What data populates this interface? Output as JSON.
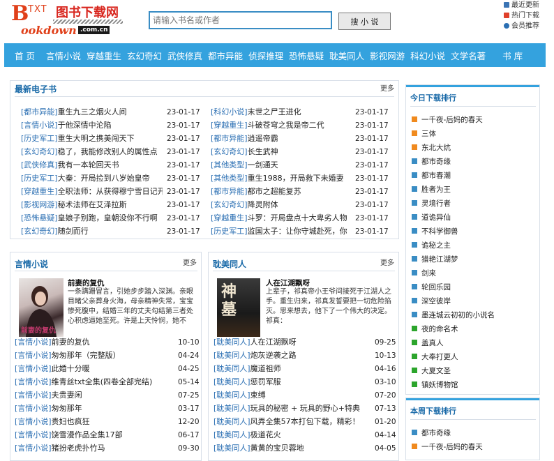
{
  "logo": {
    "txt": "TXT",
    "cn": "图书下载网",
    "b": "B",
    "bottom": "ookdown",
    "com": ".com.cn"
  },
  "search": {
    "placeholder": "请输入书名或作者",
    "button": "搜 小 说"
  },
  "toplinks": [
    {
      "label": "最近更新",
      "icon": "home-icon"
    },
    {
      "label": "热门下载",
      "icon": "chart-icon"
    },
    {
      "label": "会员推荐",
      "icon": "user-icon"
    }
  ],
  "nav": [
    "首 页",
    "言情小说",
    "穿越重生",
    "玄幻奇幻",
    "武侠修真",
    "都市异能",
    "侦探推理",
    "恐怖悬疑",
    "耽美同人",
    "影视网游",
    "科幻小说",
    "文学名著",
    "书 库"
  ],
  "latest": {
    "title": "最新电子书",
    "more": "更多",
    "left": [
      {
        "cat": "[都市异能]",
        "name": "重生九三之烟火人间",
        "date": "23-01-17"
      },
      {
        "cat": "[言情小说]",
        "name": "于他深情中沦陷",
        "date": "23-01-17"
      },
      {
        "cat": "[历史军工]",
        "name": "重生大明之携美闯天下",
        "date": "23-01-17"
      },
      {
        "cat": "[玄幻奇幻]",
        "name": "稳了，我能修改别人的属性点",
        "date": "23-01-17"
      },
      {
        "cat": "[武侠修真]",
        "name": "我有一本轮回天书",
        "date": "23-01-17"
      },
      {
        "cat": "[历史军工]",
        "name": "大秦：开局捡到八岁始皇帝",
        "date": "23-01-17"
      },
      {
        "cat": "[穿越重生]",
        "name": "全职法师：从获得穆宁雪日记开始",
        "date": "23-01-17"
      },
      {
        "cat": "[影视网游]",
        "name": "秘术法师在艾泽拉斯",
        "date": "23-01-17"
      },
      {
        "cat": "[恐怖悬疑]",
        "name": "皇娘子别跑，皇朝没你不行啊",
        "date": "23-01-17"
      },
      {
        "cat": "[玄幻奇幻]",
        "name": "随剑而行",
        "date": "23-01-17"
      }
    ],
    "right": [
      {
        "cat": "[科幻小说]",
        "name": "末世之尸王进化",
        "date": "23-01-17"
      },
      {
        "cat": "[穿越重生]",
        "name": "斗破苍穹之我是帝二代",
        "date": "23-01-17"
      },
      {
        "cat": "[都市异能]",
        "name": "逍遥帝霸",
        "date": "23-01-17"
      },
      {
        "cat": "[玄幻奇幻]",
        "name": "长生武神",
        "date": "23-01-17"
      },
      {
        "cat": "[其他类型]",
        "name": "一剑通天",
        "date": "23-01-17"
      },
      {
        "cat": "[其他类型]",
        "name": "重生1988，开局救下未婚妻",
        "date": "23-01-17"
      },
      {
        "cat": "[都市异能]",
        "name": "都市之超能复苏",
        "date": "23-01-17"
      },
      {
        "cat": "[玄幻奇幻]",
        "name": "降灵附体",
        "date": "23-01-17"
      },
      {
        "cat": "[穿越重生]",
        "name": "斗罗：开局盘点十大卑劣人物",
        "date": "23-01-17"
      },
      {
        "cat": "[历史军工]",
        "name": "监国太子：让你守城赴死，你",
        "date": "23-01-17"
      }
    ]
  },
  "romance": {
    "title": "言情小说",
    "more": "更多",
    "feature": {
      "title": "前妻的复仇",
      "cover_text": "前妻的复仇",
      "desc": "一条蹒跚冒言，引她步步踏入深渊。亲眼目睹父亲葬身火海，母亲精神失常，宝宝惨死腹中，结婚三年的丈夫勾结第三者处心积虑逼她至死。许是上天怜悯，她不"
    },
    "items": [
      {
        "cat": "[言情小说]",
        "name": "前妻的复仇",
        "date": "10-10"
      },
      {
        "cat": "[言情小说]",
        "name": "匆匆那年（完整版）",
        "date": "04-24"
      },
      {
        "cat": "[言情小说]",
        "name": "此婚十分暖",
        "date": "04-25"
      },
      {
        "cat": "[言情小说]",
        "name": "维青丝txt全集(四卷全部完结)",
        "date": "05-14"
      },
      {
        "cat": "[言情小说]",
        "name": "夫贵妻闲",
        "date": "07-25"
      },
      {
        "cat": "[言情小说]",
        "name": "匆匆那年",
        "date": "03-17"
      },
      {
        "cat": "[言情小说]",
        "name": "贵妇也疯狂",
        "date": "12-20"
      },
      {
        "cat": "[言情小说]",
        "name": "饶雪漫作品全集17部",
        "date": "06-17"
      },
      {
        "cat": "[言情小说]",
        "name": "猪扮老虎扑竹马",
        "date": "09-30"
      }
    ]
  },
  "bl": {
    "title": "耽美同人",
    "more": "更多",
    "feature": {
      "title": "人在江湖飘呀",
      "cover_text": "神墓",
      "desc": "上辈子，祁真帝小王爷间接死于江湖人之手。重生归来，祁真发誓要把一切危险掐灭。思来想去，他下了一个伟大的决定。祁真："
    },
    "items": [
      {
        "cat": "[耽美同人]",
        "name": "人在江湖飘呀",
        "date": "09-25"
      },
      {
        "cat": "[耽美同人]",
        "name": "炮灰逆袭之路",
        "date": "10-13"
      },
      {
        "cat": "[耽美同人]",
        "name": "魔道祖师",
        "date": "04-16"
      },
      {
        "cat": "[耽美同人]",
        "name": "惩罚军服",
        "date": "03-10"
      },
      {
        "cat": "[耽美同人]",
        "name": "束缚",
        "date": "07-20"
      },
      {
        "cat": "[耽美同人]",
        "name": "玩具的秘密 + 玩具的野心+特典",
        "date": "07-13"
      },
      {
        "cat": "[耽美同人]",
        "name": "风弄全集57本打包下载，精彩！",
        "date": "01-20"
      },
      {
        "cat": "[耽美同人]",
        "name": "极道花火",
        "date": "04-14"
      },
      {
        "cat": "[耽美同人]",
        "name": "黄黄的宝贝蓉地",
        "date": "04-05"
      }
    ]
  },
  "today_rank": {
    "title": "今日下载排行",
    "items": [
      {
        "label": "一千夜-后妈的春天",
        "color": "#f08a1e"
      },
      {
        "label": "三体",
        "color": "#f08a1e"
      },
      {
        "label": "东北大炕",
        "color": "#f08a1e"
      },
      {
        "label": "都市奇缘",
        "color": "#3a8dc4"
      },
      {
        "label": "都市春潮",
        "color": "#3a8dc4"
      },
      {
        "label": "胜者为王",
        "color": "#3a8dc4"
      },
      {
        "label": "灵境行者",
        "color": "#3a8dc4"
      },
      {
        "label": "道诡异仙",
        "color": "#3a8dc4"
      },
      {
        "label": "不科学御兽",
        "color": "#3a8dc4"
      },
      {
        "label": "诡秘之主",
        "color": "#3a8dc4"
      },
      {
        "label": "猎艳江湖梦",
        "color": "#3a8dc4"
      },
      {
        "label": "剑来",
        "color": "#3a8dc4"
      },
      {
        "label": "轮回乐园",
        "color": "#3a8dc4"
      },
      {
        "label": "深空彼岸",
        "color": "#3a8dc4"
      },
      {
        "label": "墨连城云初初的小说名",
        "color": "#3a8dc4"
      },
      {
        "label": "夜的命名术",
        "color": "#2ca52c"
      },
      {
        "label": "盖真人",
        "color": "#2ca52c"
      },
      {
        "label": "大奉打更人",
        "color": "#2ca52c"
      },
      {
        "label": "大夏文圣",
        "color": "#2ca52c"
      },
      {
        "label": "镇妖博物馆",
        "color": "#2ca52c"
      }
    ]
  },
  "week_rank": {
    "title": "本周下载排行",
    "items": [
      {
        "label": "都市奇缘",
        "color": "#3a8dc4"
      },
      {
        "label": "一千夜-后妈的春天",
        "color": "#f08a1e"
      }
    ]
  }
}
